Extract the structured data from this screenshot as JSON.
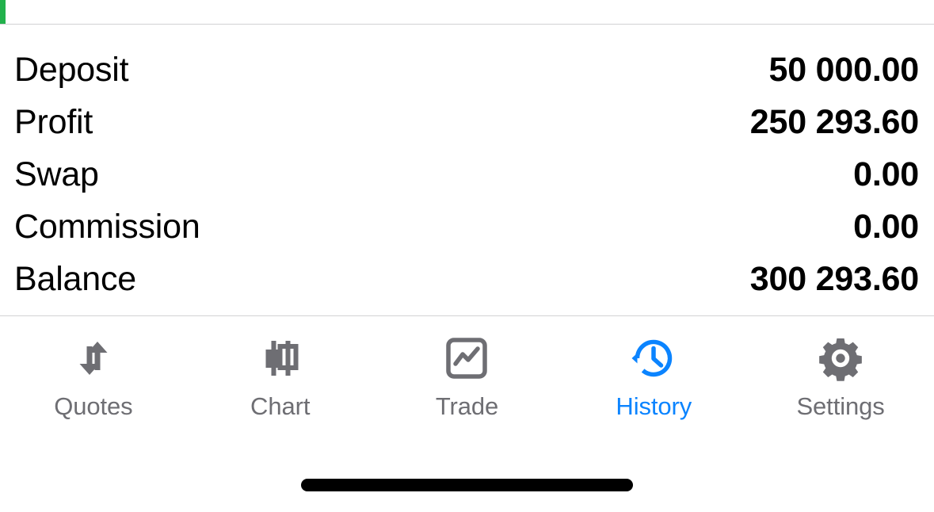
{
  "accent": {
    "color": "#22b14c",
    "name": "profit-accent-bar"
  },
  "summary": {
    "rows": [
      {
        "label": "Deposit",
        "value": "50 000.00"
      },
      {
        "label": "Profit",
        "value": "250 293.60"
      },
      {
        "label": "Swap",
        "value": "0.00"
      },
      {
        "label": "Commission",
        "value": "0.00"
      },
      {
        "label": "Balance",
        "value": "300 293.60"
      }
    ]
  },
  "tabbar": {
    "active_color": "#0b84ff",
    "inactive_color": "#6e6e73",
    "tabs": [
      {
        "label": "Quotes",
        "icon": "arrows-up-down-icon",
        "active": false
      },
      {
        "label": "Chart",
        "icon": "candlestick-icon",
        "active": false
      },
      {
        "label": "Trade",
        "icon": "chart-square-icon",
        "active": false
      },
      {
        "label": "History",
        "icon": "clock-history-icon",
        "active": true
      },
      {
        "label": "Settings",
        "icon": "gear-icon",
        "active": false
      }
    ]
  }
}
